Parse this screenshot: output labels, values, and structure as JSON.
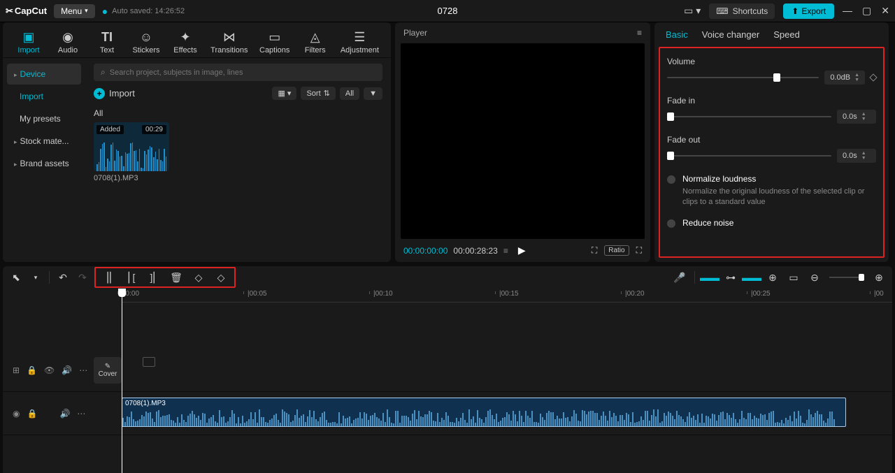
{
  "titlebar": {
    "app": "CapCut",
    "menu": "Menu",
    "autosave": "Auto saved: 14:26:52",
    "project": "0728",
    "shortcuts": "Shortcuts",
    "export": "Export"
  },
  "tabs": {
    "import": "Import",
    "audio": "Audio",
    "text": "Text",
    "stickers": "Stickers",
    "effects": "Effects",
    "transitions": "Transitions",
    "captions": "Captions",
    "filters": "Filters",
    "adjustment": "Adjustment"
  },
  "sidebar": {
    "device": "Device",
    "import": "Import",
    "presets": "My presets",
    "stock": "Stock mate...",
    "brand": "Brand assets"
  },
  "media": {
    "search_placeholder": "Search project, subjects in image, lines",
    "import_label": "Import",
    "sort": "Sort",
    "all_btn": "All",
    "all_label": "All",
    "item_badge": "Added",
    "item_dur": "00:29",
    "item_name": "0708(1).MP3"
  },
  "player": {
    "title": "Player",
    "current": "00:00:00:00",
    "total": "00:00:28:23",
    "ratio": "Ratio"
  },
  "props": {
    "tab_basic": "Basic",
    "tab_voice": "Voice changer",
    "tab_speed": "Speed",
    "volume_label": "Volume",
    "volume_val": "0.0dB",
    "fadein_label": "Fade in",
    "fadein_val": "0.0s",
    "fadeout_label": "Fade out",
    "fadeout_val": "0.0s",
    "normalize_label": "Normalize loudness",
    "normalize_desc": "Normalize the original loudness of the selected clip or clips to a standard value",
    "reduce_label": "Reduce noise"
  },
  "timeline": {
    "ticks": [
      "00:00",
      "|00:05",
      "|00:10",
      "|00:15",
      "|00:20",
      "|00:25",
      "|00"
    ],
    "cover": "Cover",
    "clip_name": "0708(1).MP3"
  }
}
